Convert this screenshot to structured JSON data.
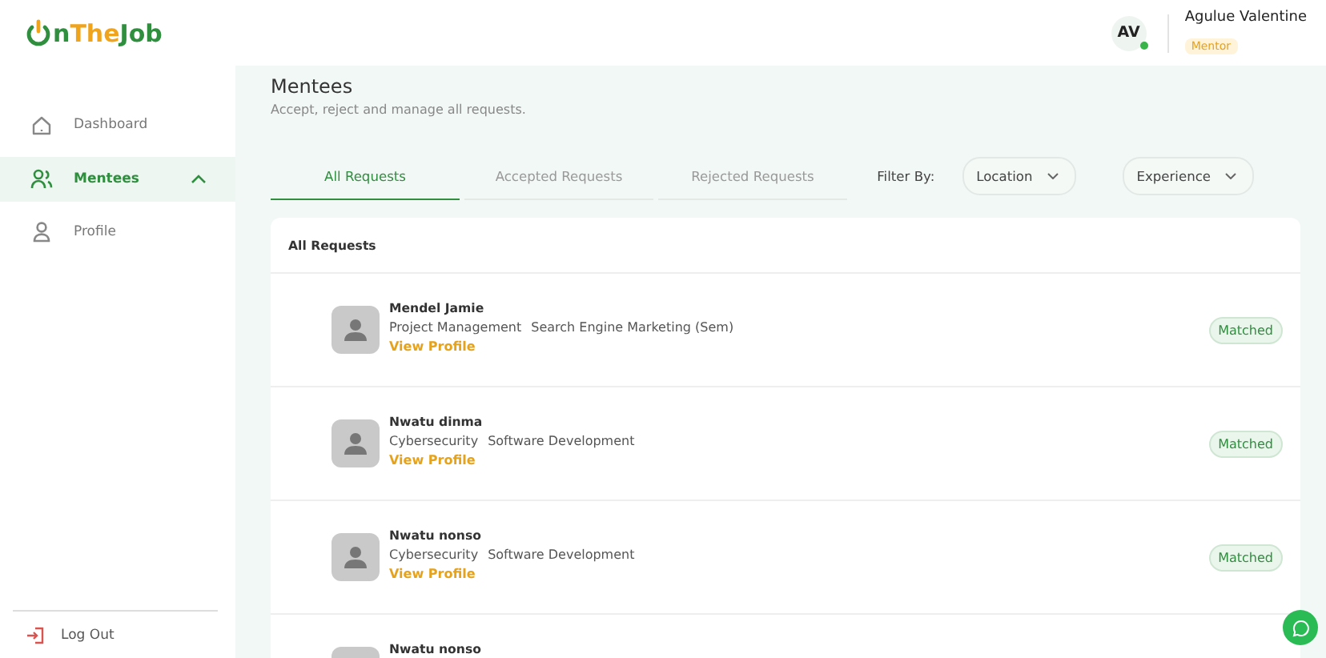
{
  "logo": {
    "parts": [
      {
        "text": "n",
        "color": "#2f8f3f"
      },
      {
        "text": "The",
        "color": "#f0a41c"
      },
      {
        "text": "Job",
        "color": "#2f8f3f"
      }
    ]
  },
  "user": {
    "initials": "AV",
    "online": true,
    "name": "Agulue Valentine",
    "role": "Mentor"
  },
  "sidebar": {
    "items": [
      {
        "kind": "home",
        "label": "Dashboard",
        "selected": false,
        "expanded": false
      },
      {
        "kind": "people",
        "label": "Mentees",
        "selected": true,
        "expanded": true
      },
      {
        "kind": "person",
        "label": "Profile",
        "selected": false,
        "expanded": false
      }
    ],
    "logout": "Log Out"
  },
  "page": {
    "title": "Mentees",
    "subtitle": "Accept, reject and manage all requests."
  },
  "tabs": [
    {
      "label": "All Requests",
      "selected": true
    },
    {
      "label": "Accepted Requests",
      "selected": false
    },
    {
      "label": "Rejected Requests",
      "selected": false
    }
  ],
  "filters": {
    "label": "Filter By:",
    "dropdowns": [
      "Location",
      "Experience"
    ]
  },
  "list": {
    "title": "All Requests",
    "rows": [
      {
        "name": "Mendel Jamie",
        "skills": [
          "Project Management",
          "Search Engine Marketing (Sem)"
        ],
        "link": "View Profile",
        "status": "Matched"
      },
      {
        "name": "Nwatu dinma",
        "skills": [
          "Cybersecurity",
          "Software Development"
        ],
        "link": "View Profile",
        "status": "Matched"
      },
      {
        "name": "Nwatu nonso",
        "skills": [
          "Cybersecurity",
          "Software Development"
        ],
        "link": "View Profile",
        "status": "Matched"
      },
      {
        "name": "Nwatu nonso"
      }
    ]
  }
}
